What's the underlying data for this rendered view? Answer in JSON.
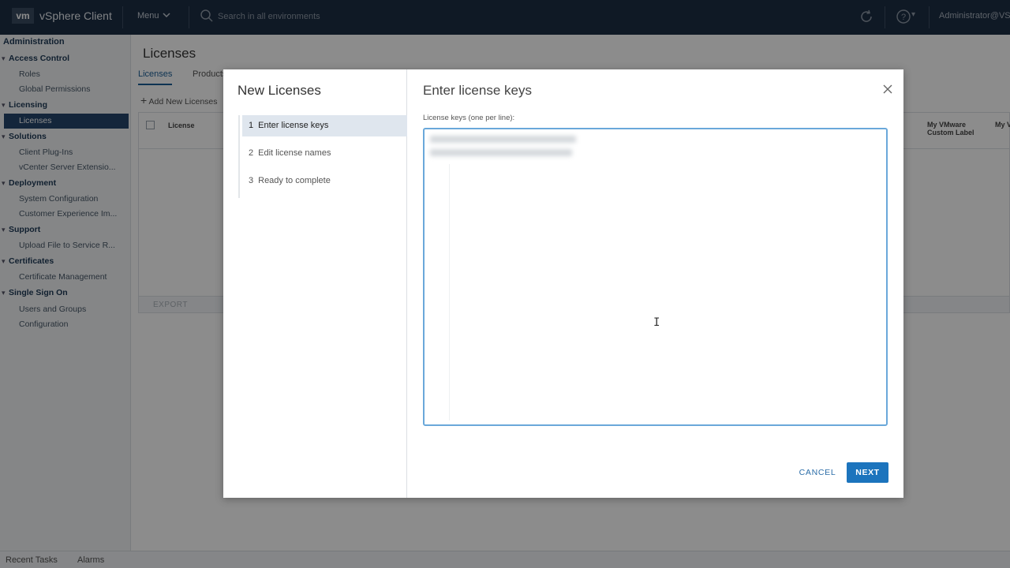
{
  "topbar": {
    "logo": "vm",
    "app_name": "vSphere Client",
    "menu_label": "Menu",
    "search_placeholder": "Search in all environments",
    "user": "Administrator@VSPHERE.LOCAL"
  },
  "sidebar": {
    "title": "Administration",
    "items": [
      {
        "label": "Access Control",
        "type": "section"
      },
      {
        "label": "Roles",
        "type": "child"
      },
      {
        "label": "Global Permissions",
        "type": "child"
      },
      {
        "label": "Licensing",
        "type": "section"
      },
      {
        "label": "Licenses",
        "type": "child",
        "active": true
      },
      {
        "label": "Solutions",
        "type": "section"
      },
      {
        "label": "Client Plug-Ins",
        "type": "child"
      },
      {
        "label": "vCenter Server Extensio...",
        "type": "child"
      },
      {
        "label": "Deployment",
        "type": "section"
      },
      {
        "label": "System Configuration",
        "type": "child"
      },
      {
        "label": "Customer Experience Im...",
        "type": "child"
      },
      {
        "label": "Support",
        "type": "section"
      },
      {
        "label": "Upload File to Service R...",
        "type": "child"
      },
      {
        "label": "Certificates",
        "type": "section"
      },
      {
        "label": "Certificate Management",
        "type": "child"
      },
      {
        "label": "Single Sign On",
        "type": "section"
      },
      {
        "label": "Users and Groups",
        "type": "child"
      },
      {
        "label": "Configuration",
        "type": "child"
      }
    ]
  },
  "main": {
    "title": "Licenses",
    "tabs": [
      "Licenses",
      "Products"
    ],
    "add_button": "Add New Licenses",
    "columns": {
      "license": "License",
      "custom_label": "My VMware Custom Label",
      "account": "My VMware Account"
    },
    "export": "EXPORT"
  },
  "bottombar": {
    "recent_tasks": "Recent Tasks",
    "alarms": "Alarms"
  },
  "modal": {
    "wizard_title": "New Licenses",
    "steps": [
      {
        "num": "1",
        "label": "Enter license keys",
        "active": true
      },
      {
        "num": "2",
        "label": "Edit license names"
      },
      {
        "num": "3",
        "label": "Ready to complete"
      }
    ],
    "content_title": "Enter license keys",
    "field_label": "License keys (one per line):",
    "cancel": "CANCEL",
    "next": "NEXT"
  },
  "colors": {
    "topbar": "#1d2f44",
    "active_nav": "#25466c",
    "primary_button": "#1c74bd",
    "focus_border": "#6aa8da"
  }
}
